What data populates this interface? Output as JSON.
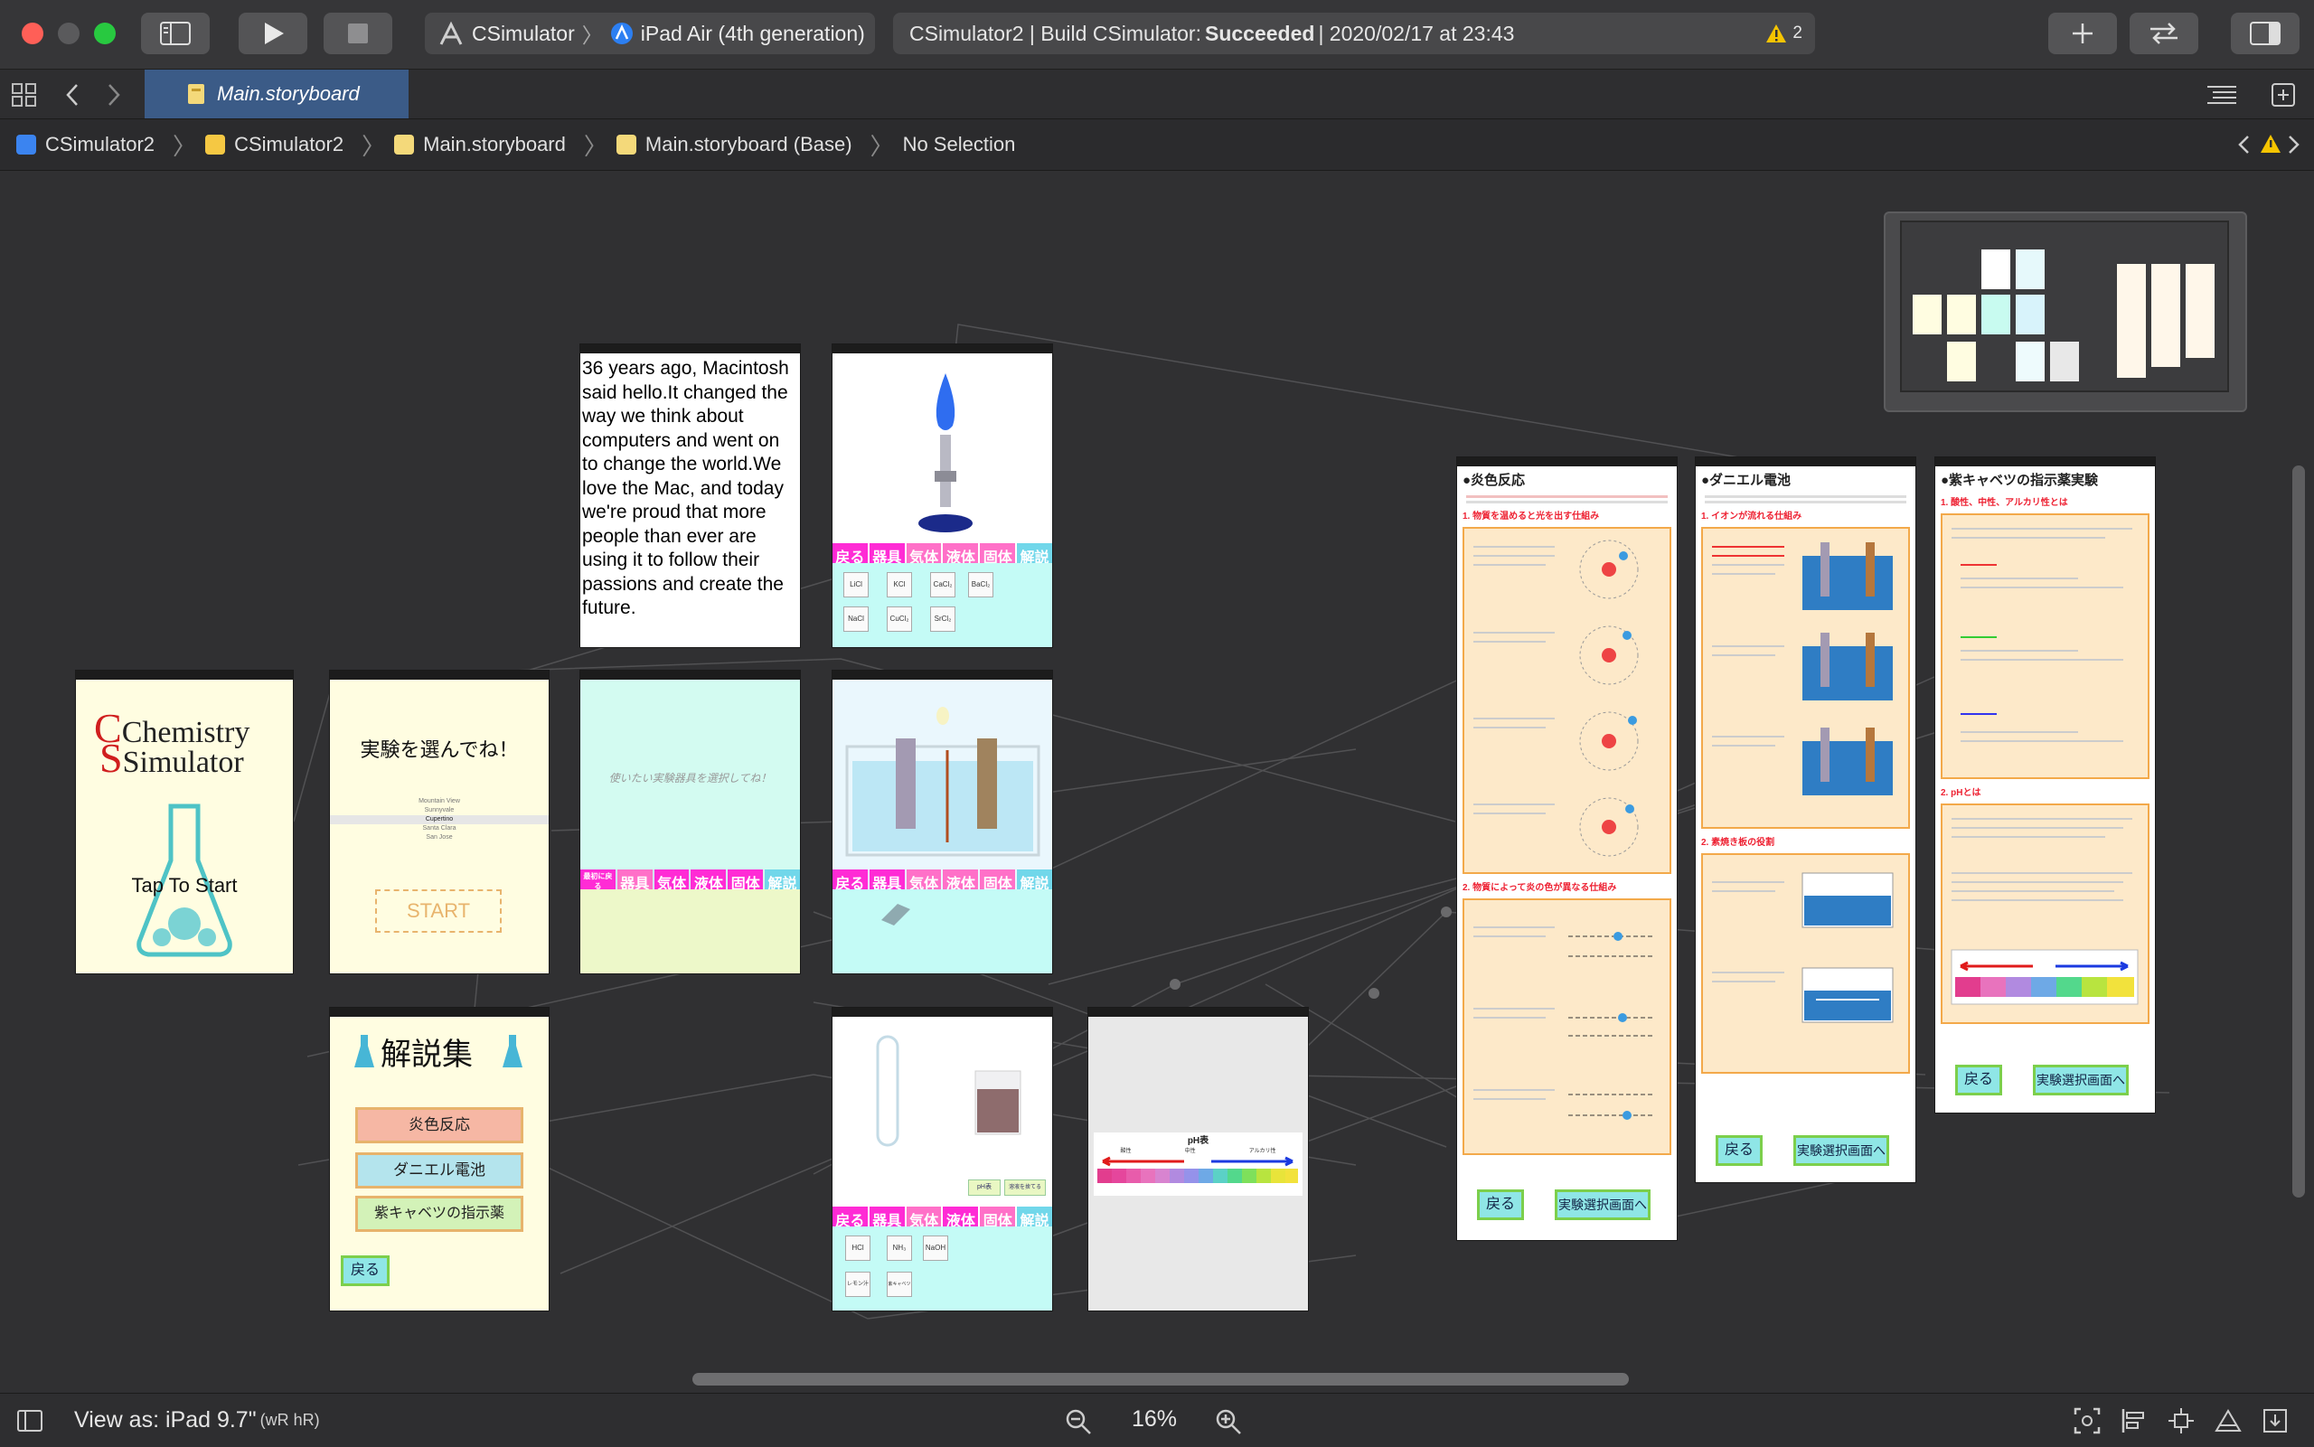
{
  "toolbar": {
    "scheme_target": "CSimulator",
    "device": "iPad Air (4th generation)",
    "status_prefix": "CSimulator2 | Build CSimulator: ",
    "status_result": "Succeeded",
    "status_suffix": " | 2020/02/17 at 23:43",
    "warning_count": "2"
  },
  "tabbar": {
    "active_tab": "Main.storyboard"
  },
  "pathbar": {
    "items": [
      "CSimulator2",
      "CSimulator2",
      "Main.storyboard",
      "Main.storyboard (Base)",
      "No Selection"
    ]
  },
  "scenes": {
    "title": {
      "logo_line1": "Chemistry",
      "logo_line2": "Simulator",
      "tap": "Tap To Start"
    },
    "select": {
      "heading": "実験を選んでね！",
      "picker": [
        "Mountain View",
        "Sunnyvale",
        "Cupertino",
        "Santa Clara",
        "San Jose"
      ],
      "start": "START"
    },
    "text": {
      "body": "36 years ago, Macintosh said hello.It changed the way we think about computers and went on to change the world.We love the Mac, and today we're proud that more people than ever are using it to follow their passions and create the future."
    },
    "burner": {
      "buttons": [
        "戻る",
        "器具",
        "気体",
        "液体",
        "固体",
        "解説"
      ],
      "tiles": [
        "LiCl",
        "KCl",
        "CaCl₂",
        "BaCl₂",
        "NaCl",
        "CuCl₂",
        "SrCl₂"
      ]
    },
    "instruments": {
      "caption": "使いたい実験器具を選択してね！",
      "buttons": [
        "最初に戻る",
        "器具",
        "気体",
        "液体",
        "固体",
        "解説"
      ]
    },
    "battery": {
      "buttons": [
        "戻る",
        "器具",
        "気体",
        "液体",
        "固体",
        "解説"
      ]
    },
    "commentary": {
      "title": "解説集",
      "items": [
        "炎色反応",
        "ダニエル電池",
        "紫キャベツの指示薬"
      ],
      "back": "戻る"
    },
    "tube": {
      "buttons": [
        "戻る",
        "器具",
        "気体",
        "液体",
        "固体",
        "解説"
      ],
      "small_buttons": [
        "pH表",
        "溶液を捨てる"
      ],
      "tiles": [
        "HCl",
        "NH₃",
        "NaOH",
        "レモン汁",
        "紫キャベツ"
      ]
    },
    "ph": {
      "title": "pH表",
      "labels": [
        "酸性",
        "中性",
        "アルカリ性"
      ]
    },
    "doc1": {
      "title": "●炎色反応",
      "sec1": "1. 物質を温めると光を出す仕組み",
      "sec2": "2. 物質によって炎の色が異なる仕組み",
      "back": "戻る",
      "next": "実験選択画面へ"
    },
    "doc2": {
      "title": "●ダニエル電池",
      "sec1": "1. イオンが流れる仕組み",
      "sec2": "2. 素焼き板の役割",
      "back": "戻る",
      "next": "実験選択画面へ"
    },
    "doc3": {
      "title": "●紫キャベツの指示薬実験",
      "sec1": "1. 酸性、中性、アルカリ性とは",
      "sec2": "2. pHとは",
      "back": "戻る",
      "next": "実験選択画面へ"
    }
  },
  "bottombar": {
    "view_as": "View as: iPad 9.7\"",
    "size_class": " (wR hR)",
    "zoom": "16%"
  }
}
